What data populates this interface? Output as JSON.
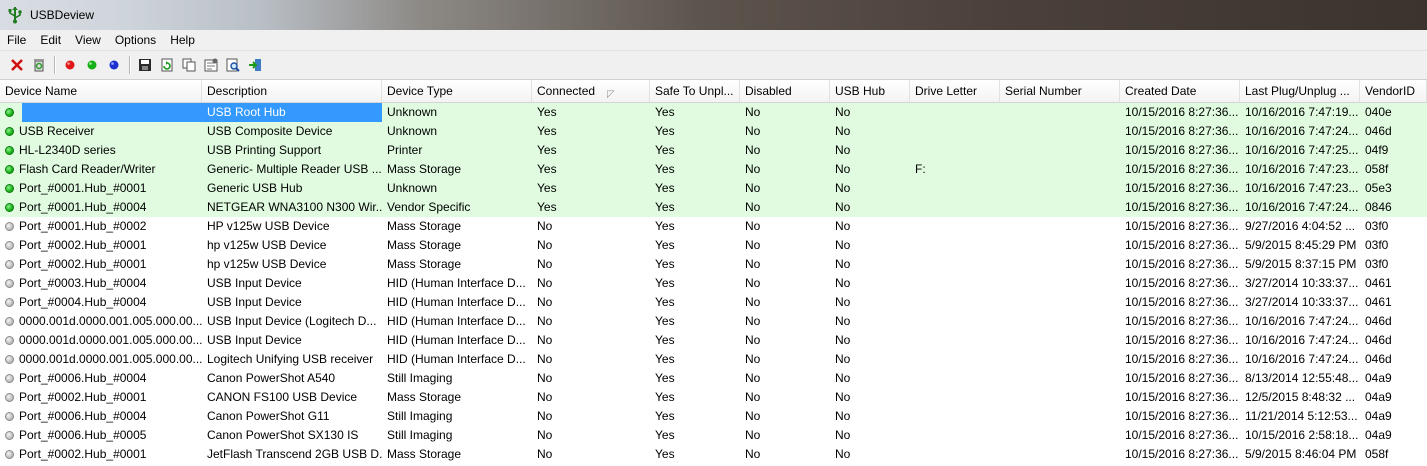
{
  "window": {
    "title": "USBDeview"
  },
  "menu": [
    "File",
    "Edit",
    "View",
    "Options",
    "Help"
  ],
  "columns": [
    {
      "label": "Device Name",
      "w": 202
    },
    {
      "label": "Description",
      "w": 180
    },
    {
      "label": "Device Type",
      "w": 150
    },
    {
      "label": "Connected",
      "w": 118
    },
    {
      "label": "Safe To Unpl...",
      "w": 90
    },
    {
      "label": "Disabled",
      "w": 90
    },
    {
      "label": "USB Hub",
      "w": 80
    },
    {
      "label": "Drive Letter",
      "w": 90
    },
    {
      "label": "Serial Number",
      "w": 120
    },
    {
      "label": "Created Date",
      "w": 120
    },
    {
      "label": "Last Plug/Unplug ...",
      "w": 120
    },
    {
      "label": "VendorID",
      "w": 67
    }
  ],
  "rows": [
    {
      "status": "on",
      "selected": true,
      "name": "",
      "desc": "USB Root Hub",
      "type": "Unknown",
      "connected": "Yes",
      "safe": "Yes",
      "disabled": "No",
      "hub": "No",
      "drive": "",
      "serial": "",
      "created": "10/15/2016 8:27:36...",
      "last": "10/16/2016 7:47:19...",
      "vendor": "040e"
    },
    {
      "status": "on",
      "name": "USB Receiver",
      "desc": "USB Composite Device",
      "type": "Unknown",
      "connected": "Yes",
      "safe": "Yes",
      "disabled": "No",
      "hub": "No",
      "drive": "",
      "serial": "",
      "created": "10/15/2016 8:27:36...",
      "last": "10/16/2016 7:47:24...",
      "vendor": "046d"
    },
    {
      "status": "on",
      "name": "HL-L2340D series",
      "desc": "USB Printing Support",
      "type": "Printer",
      "connected": "Yes",
      "safe": "Yes",
      "disabled": "No",
      "hub": "No",
      "drive": "",
      "serial": "",
      "created": "10/15/2016 8:27:36...",
      "last": "10/16/2016 7:47:25...",
      "vendor": "04f9"
    },
    {
      "status": "on",
      "name": "Flash Card Reader/Writer",
      "desc": "Generic- Multiple Reader USB ...",
      "type": "Mass Storage",
      "connected": "Yes",
      "safe": "Yes",
      "disabled": "No",
      "hub": "No",
      "drive": "F:",
      "serial": "",
      "created": "10/15/2016 8:27:36...",
      "last": "10/16/2016 7:47:23...",
      "vendor": "058f"
    },
    {
      "status": "on",
      "name": "Port_#0001.Hub_#0001",
      "desc": "Generic USB Hub",
      "type": "Unknown",
      "connected": "Yes",
      "safe": "Yes",
      "disabled": "No",
      "hub": "No",
      "drive": "",
      "serial": "",
      "created": "10/15/2016 8:27:36...",
      "last": "10/16/2016 7:47:23...",
      "vendor": "05e3"
    },
    {
      "status": "on",
      "name": "Port_#0001.Hub_#0004",
      "desc": "NETGEAR WNA3100 N300 Wir...",
      "type": "Vendor Specific",
      "connected": "Yes",
      "safe": "Yes",
      "disabled": "No",
      "hub": "No",
      "drive": "",
      "serial": "",
      "created": "10/15/2016 8:27:36...",
      "last": "10/16/2016 7:47:24...",
      "vendor": "0846"
    },
    {
      "status": "off",
      "name": "Port_#0001.Hub_#0002",
      "desc": "HP v125w USB Device",
      "type": "Mass Storage",
      "connected": "No",
      "safe": "Yes",
      "disabled": "No",
      "hub": "No",
      "drive": "",
      "serial": "",
      "created": "10/15/2016 8:27:36...",
      "last": "9/27/2016 4:04:52 ...",
      "vendor": "03f0"
    },
    {
      "status": "off",
      "name": "Port_#0002.Hub_#0001",
      "desc": "hp v125w USB Device",
      "type": "Mass Storage",
      "connected": "No",
      "safe": "Yes",
      "disabled": "No",
      "hub": "No",
      "drive": "",
      "serial": "",
      "created": "10/15/2016 8:27:36...",
      "last": "5/9/2015 8:45:29 PM",
      "vendor": "03f0"
    },
    {
      "status": "off",
      "name": "Port_#0002.Hub_#0001",
      "desc": "hp v125w USB Device",
      "type": "Mass Storage",
      "connected": "No",
      "safe": "Yes",
      "disabled": "No",
      "hub": "No",
      "drive": "",
      "serial": "",
      "created": "10/15/2016 8:27:36...",
      "last": "5/9/2015 8:37:15 PM",
      "vendor": "03f0"
    },
    {
      "status": "off",
      "name": "Port_#0003.Hub_#0004",
      "desc": "USB Input Device",
      "type": "HID (Human Interface D...",
      "connected": "No",
      "safe": "Yes",
      "disabled": "No",
      "hub": "No",
      "drive": "",
      "serial": "",
      "created": "10/15/2016 8:27:36...",
      "last": "3/27/2014 10:33:37...",
      "vendor": "0461"
    },
    {
      "status": "off",
      "name": "Port_#0004.Hub_#0004",
      "desc": "USB Input Device",
      "type": "HID (Human Interface D...",
      "connected": "No",
      "safe": "Yes",
      "disabled": "No",
      "hub": "No",
      "drive": "",
      "serial": "",
      "created": "10/15/2016 8:27:36...",
      "last": "3/27/2014 10:33:37...",
      "vendor": "0461"
    },
    {
      "status": "off",
      "name": "0000.001d.0000.001.005.000.00...",
      "desc": "USB Input Device (Logitech D...",
      "type": "HID (Human Interface D...",
      "connected": "No",
      "safe": "Yes",
      "disabled": "No",
      "hub": "No",
      "drive": "",
      "serial": "",
      "created": "10/15/2016 8:27:36...",
      "last": "10/16/2016 7:47:24...",
      "vendor": "046d"
    },
    {
      "status": "off",
      "name": "0000.001d.0000.001.005.000.00...",
      "desc": "USB Input Device",
      "type": "HID (Human Interface D...",
      "connected": "No",
      "safe": "Yes",
      "disabled": "No",
      "hub": "No",
      "drive": "",
      "serial": "",
      "created": "10/15/2016 8:27:36...",
      "last": "10/16/2016 7:47:24...",
      "vendor": "046d"
    },
    {
      "status": "off",
      "name": "0000.001d.0000.001.005.000.00...",
      "desc": "Logitech Unifying USB receiver",
      "type": "HID (Human Interface D...",
      "connected": "No",
      "safe": "Yes",
      "disabled": "No",
      "hub": "No",
      "drive": "",
      "serial": "",
      "created": "10/15/2016 8:27:36...",
      "last": "10/16/2016 7:47:24...",
      "vendor": "046d"
    },
    {
      "status": "off",
      "name": "Port_#0006.Hub_#0004",
      "desc": "Canon PowerShot A540",
      "type": "Still Imaging",
      "connected": "No",
      "safe": "Yes",
      "disabled": "No",
      "hub": "No",
      "drive": "",
      "serial": "",
      "created": "10/15/2016 8:27:36...",
      "last": "8/13/2014 12:55:48...",
      "vendor": "04a9"
    },
    {
      "status": "off",
      "name": "Port_#0002.Hub_#0001",
      "desc": "CANON FS100 USB Device",
      "type": "Mass Storage",
      "connected": "No",
      "safe": "Yes",
      "disabled": "No",
      "hub": "No",
      "drive": "",
      "serial": "",
      "created": "10/15/2016 8:27:36...",
      "last": "12/5/2015 8:48:32 ...",
      "vendor": "04a9"
    },
    {
      "status": "off",
      "name": "Port_#0006.Hub_#0004",
      "desc": "Canon PowerShot G11",
      "type": "Still Imaging",
      "connected": "No",
      "safe": "Yes",
      "disabled": "No",
      "hub": "No",
      "drive": "",
      "serial": "",
      "created": "10/15/2016 8:27:36...",
      "last": "11/21/2014 5:12:53...",
      "vendor": "04a9"
    },
    {
      "status": "off",
      "name": "Port_#0006.Hub_#0005",
      "desc": "Canon PowerShot SX130 IS",
      "type": "Still Imaging",
      "connected": "No",
      "safe": "Yes",
      "disabled": "No",
      "hub": "No",
      "drive": "",
      "serial": "",
      "created": "10/15/2016 8:27:36...",
      "last": "10/15/2016 2:58:18...",
      "vendor": "04a9"
    },
    {
      "status": "off",
      "name": "Port_#0002.Hub_#0001",
      "desc": "JetFlash Transcend 2GB USB D...",
      "type": "Mass Storage",
      "connected": "No",
      "safe": "Yes",
      "disabled": "No",
      "hub": "No",
      "drive": "",
      "serial": "",
      "created": "10/15/2016 8:27:36...",
      "last": "5/9/2015 8:46:04 PM",
      "vendor": "058f"
    }
  ],
  "icons": {
    "toolbar": [
      "uninstall-icon",
      "recycle-icon",
      "red-dot-icon",
      "green-dot-icon",
      "blue-dot-icon",
      "save-icon",
      "refresh-icon",
      "copy-icon",
      "properties-icon",
      "find-icon",
      "exit-icon"
    ]
  }
}
